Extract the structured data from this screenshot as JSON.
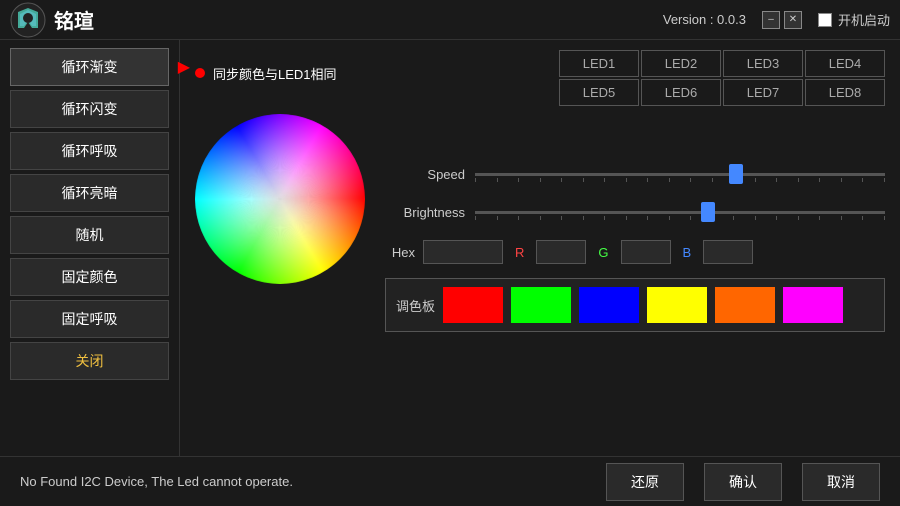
{
  "titleBar": {
    "appName": "铭瑄",
    "version": "Version : 0.0.3",
    "startupLabel": "开机启动",
    "minimizeLabel": "–",
    "closeLabel": "✕"
  },
  "sidebar": {
    "items": [
      {
        "id": "cycle-gradient",
        "label": "循环渐变",
        "active": true
      },
      {
        "id": "cycle-flash",
        "label": "循环闪变"
      },
      {
        "id": "cycle-breathe",
        "label": "循环呼吸"
      },
      {
        "id": "cycle-dark",
        "label": "循环亮暗"
      },
      {
        "id": "random",
        "label": "随机"
      },
      {
        "id": "fixed-color",
        "label": "固定颜色"
      },
      {
        "id": "fixed-breathe",
        "label": "固定呼吸"
      },
      {
        "id": "close",
        "label": "关闭",
        "isClose": true
      }
    ]
  },
  "content": {
    "syncLabel": "同步颜色与LED1相同",
    "ledButtons": [
      "LED1",
      "LED2",
      "LED3",
      "LED4",
      "LED5",
      "LED6",
      "LED7",
      "LED8"
    ],
    "speedLabel": "Speed",
    "brightnessLabel": "Brightness",
    "hexLabel": "Hex",
    "rLabel": "R",
    "gLabel": "G",
    "bLabel": "B",
    "paletteLabel": "调色板",
    "speedThumbPos": "62",
    "brightnessThumbPos": "55",
    "palette": [
      {
        "color": "#ff0000"
      },
      {
        "color": "#00ff00"
      },
      {
        "color": "#0000ff"
      },
      {
        "color": "#ffff00"
      },
      {
        "color": "#ff6600"
      },
      {
        "color": "#ff00ff"
      }
    ]
  },
  "bottomBar": {
    "statusText": "No Found I2C Device, The Led cannot operate.",
    "restoreLabel": "还原",
    "confirmLabel": "确认",
    "cancelLabel": "取消"
  }
}
